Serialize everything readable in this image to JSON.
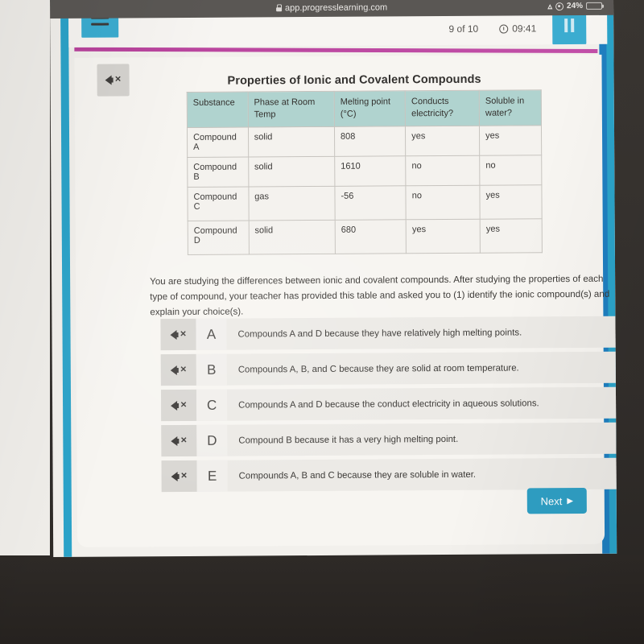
{
  "browser": {
    "url": "app.progresslearning.com",
    "lock_icon": "lock-icon"
  },
  "status_bar": {
    "wifi_icon": "wifi-icon",
    "location_icon": "location-icon",
    "battery_percent": "24%",
    "battery_icon": "battery-icon"
  },
  "app_bar": {
    "menu_icon": "hamburger-menu-icon",
    "question_progress": "9 of 10",
    "timer": "09:41",
    "clock_icon": "clock-icon",
    "pause_icon": "pause-icon"
  },
  "question": {
    "mute_icon": "speaker-mute-icon",
    "table_title": "Properties of Ionic and Covalent Compounds",
    "prompt": "You are studying the differences between ionic and covalent compounds. After studying the properties of each type of compound, your teacher has provided this table and asked you to (1) identify the ionic compound(s) and explain your choice(s)."
  },
  "table": {
    "headers": [
      "Substance",
      "Phase at Room Temp",
      "Melting point (°C)",
      "Conducts electricity?",
      "Soluble in water?"
    ],
    "rows": [
      {
        "substance": "Compound A",
        "phase": "solid",
        "melting_point": "808",
        "conducts": "yes",
        "soluble": "yes"
      },
      {
        "substance": "Compound B",
        "phase": "solid",
        "melting_point": "1610",
        "conducts": "no",
        "soluble": "no"
      },
      {
        "substance": "Compound C",
        "phase": "gas",
        "melting_point": "-56",
        "conducts": "no",
        "soluble": "yes"
      },
      {
        "substance": "Compound D",
        "phase": "solid",
        "melting_point": "680",
        "conducts": "yes",
        "soluble": "yes"
      }
    ]
  },
  "options": [
    {
      "letter": "A",
      "text": "Compounds A and D because they have relatively high melting points.",
      "mute_icon": "speaker-mute-icon"
    },
    {
      "letter": "B",
      "text": "Compounds A, B, and C because they are solid at room temperature.",
      "mute_icon": "speaker-mute-icon"
    },
    {
      "letter": "C",
      "text": "Compounds A and D because the conduct electricity in aqueous solutions.",
      "mute_icon": "speaker-mute-icon"
    },
    {
      "letter": "D",
      "text": "Compound B because it has a very high melting point.",
      "mute_icon": "speaker-mute-icon"
    },
    {
      "letter": "E",
      "text": "Compounds A, B and C because they are soluble in water.",
      "mute_icon": "speaker-mute-icon"
    }
  ],
  "footer": {
    "next_label": "Next",
    "next_arrow": "▶"
  },
  "colors": {
    "accent_teal": "#2f9fc4",
    "table_header": "#b0d3cf",
    "progress_pink": "#b8439c"
  }
}
